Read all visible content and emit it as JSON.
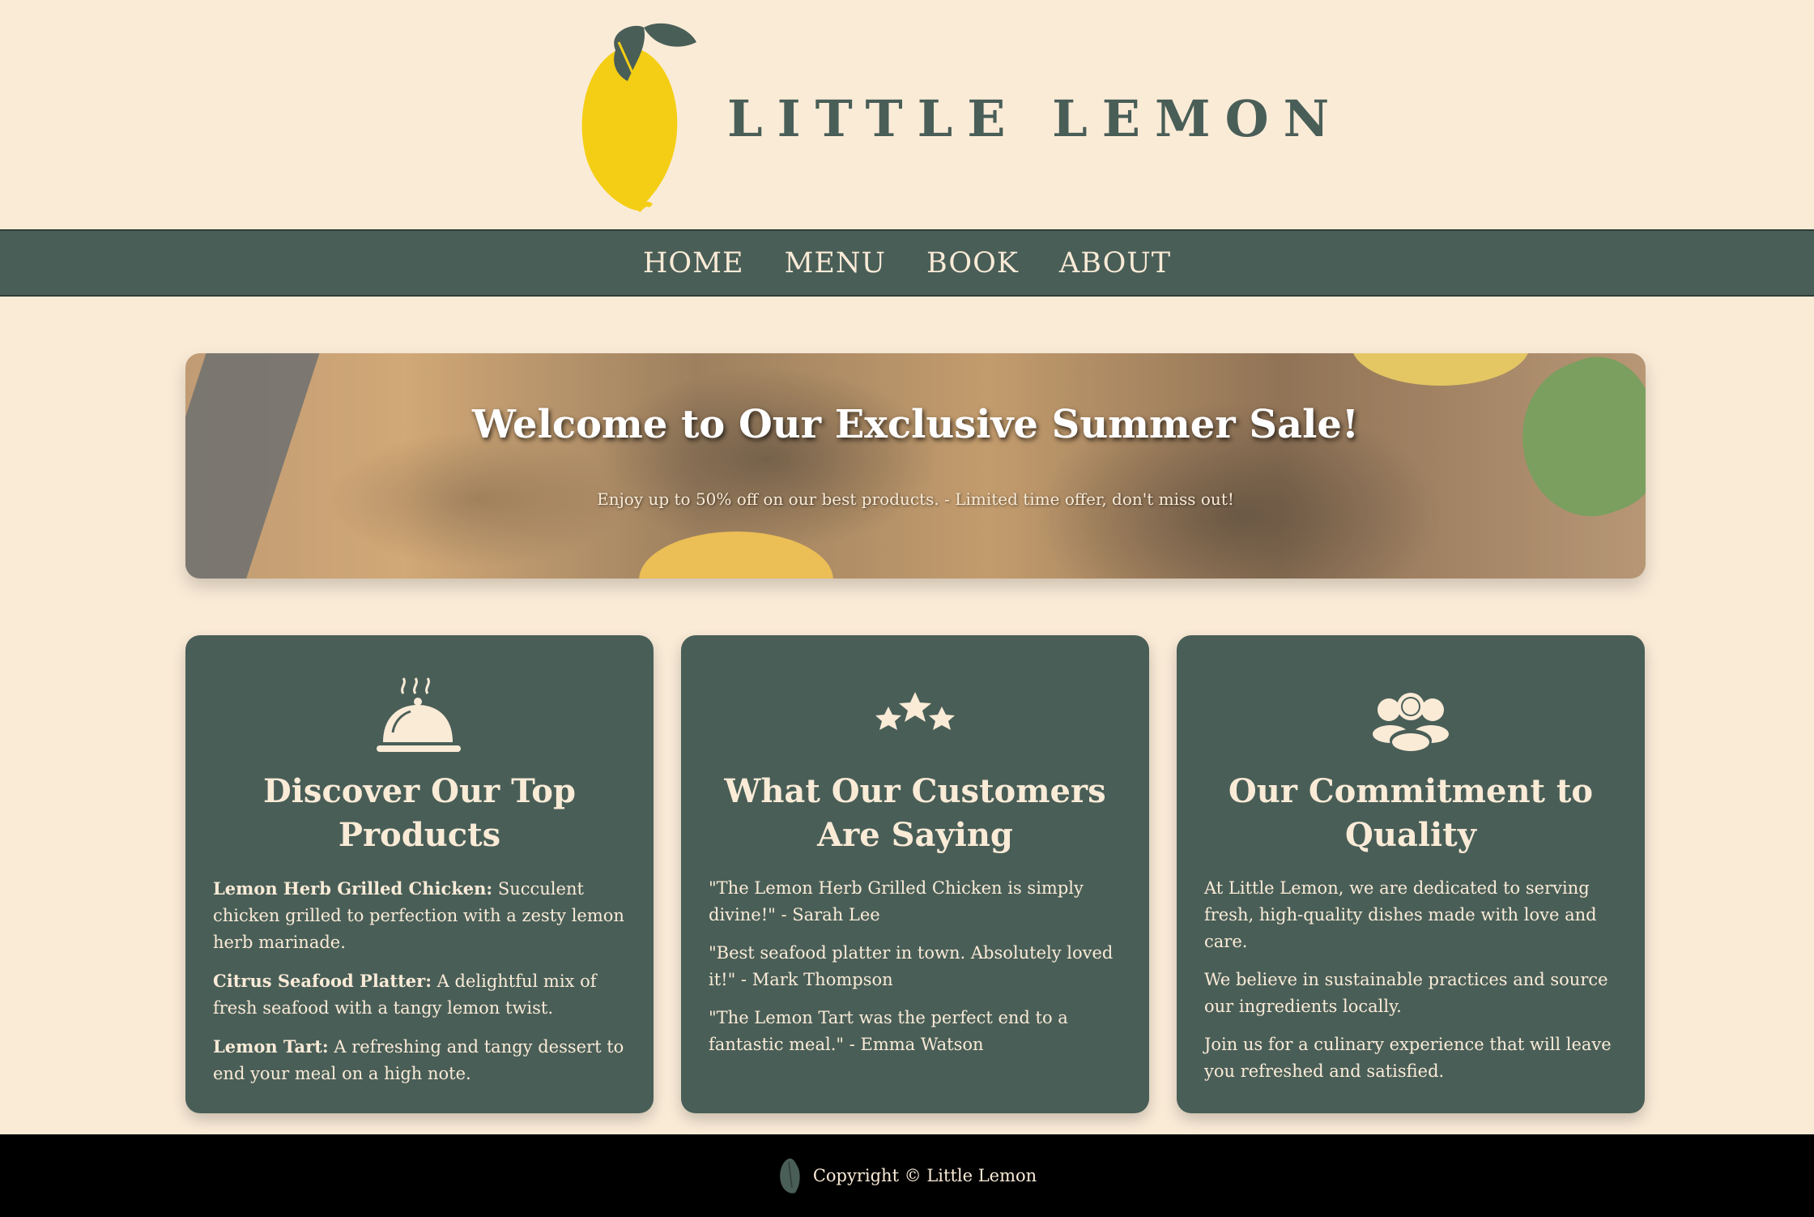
{
  "brand": {
    "name": "LITTLE LEMON",
    "logo_icon": "lemon-logo-icon"
  },
  "nav": {
    "items": [
      {
        "label": "HOME"
      },
      {
        "label": "MENU"
      },
      {
        "label": "BOOK"
      },
      {
        "label": "ABOUT"
      }
    ]
  },
  "hero": {
    "title": "Welcome to Our Exclusive Summer Sale!",
    "subtitle": "Enjoy up to 50% off on our best products. - Limited time offer, don't miss out!"
  },
  "cards": [
    {
      "icon": "cloche-icon",
      "title": "Discover Our Top Products",
      "items": [
        {
          "name": "Lemon Herb Grilled Chicken:",
          "desc": " Succulent chicken grilled to perfection with a zesty lemon herb marinade."
        },
        {
          "name": "Citrus Seafood Platter:",
          "desc": " A delightful mix of fresh seafood with a tangy lemon twist."
        },
        {
          "name": "Lemon Tart:",
          "desc": " A refreshing and tangy dessert to end your meal on a high note."
        }
      ]
    },
    {
      "icon": "stars-icon",
      "title": "What Our Customers Are Saying",
      "items": [
        "\"The Lemon Herb Grilled Chicken is simply divine!\" - Sarah Lee",
        "\"Best seafood platter in town. Absolutely loved it!\" - Mark Thompson",
        "\"The Lemon Tart was the perfect end to a fantastic meal.\" - Emma Watson"
      ]
    },
    {
      "icon": "people-icon",
      "title": "Our Commitment to Quality",
      "items": [
        "At Little Lemon, we are dedicated to serving fresh, high-quality dishes made with love and care.",
        "We believe in sustainable practices and source our ingredients locally.",
        "Join us for a culinary experience that will leave you refreshed and satisfied."
      ]
    }
  ],
  "footer": {
    "text": "Copyright © Little Lemon",
    "icon": "lemon-small-icon"
  },
  "colors": {
    "background": "#FAEBD7",
    "primary": "#495E57",
    "lemon": "#F4CE14",
    "footer": "#000000"
  }
}
